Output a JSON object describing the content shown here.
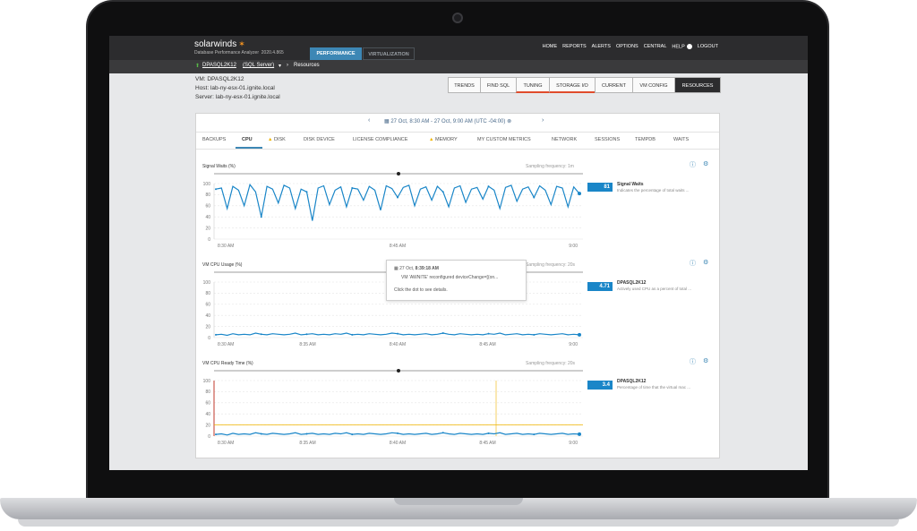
{
  "app": {
    "brand": "solarwinds",
    "product": "Database Performance Analyzer",
    "version": "2020.4.865",
    "main_tabs": [
      "PERFORMANCE",
      "VIRTUALIZATION"
    ],
    "nav": [
      "HOME",
      "REPORTS",
      "ALERTS",
      "OPTIONS",
      "CENTRAL",
      "HELP",
      "LOGOUT"
    ]
  },
  "breadcrumb": {
    "instance": "DPASQL2K12",
    "type": "(SQL Server)",
    "page": "Resources"
  },
  "info": {
    "vm": "VM: DPASQL2K12",
    "host": "Host: lab-ny-esx-01.ignite.local",
    "server": "Server: lab-ny-esx-01.ignite.local"
  },
  "view_tabs": [
    "TRENDS",
    "FIND SQL",
    "TUNING",
    "STORAGE I/O",
    "CURRENT",
    "VM CONFIG",
    "RESOURCES"
  ],
  "date_range": "27 Oct, 8:30 AM - 27 Oct, 9:00 AM (UTC -04:00)",
  "resource_tabs": [
    "BACKUPS",
    "CPU",
    "DISK",
    "DISK DEVICE",
    "LICENSE COMPLIANCE",
    "MEMORY",
    "MY CUSTOM METRICS",
    "NETWORK",
    "SESSIONS",
    "TEMPDB",
    "WAITS"
  ],
  "colors": {
    "accent": "#3d87b5",
    "series": "#1a86c8",
    "threshold": "#f0b400",
    "critical": "#e04c2c"
  },
  "charts": [
    {
      "title": "Signal Waits (%)",
      "sampling": "Sampling frequency: 1m",
      "current_value": "81",
      "legend_name": "Signal Waits",
      "legend_desc": "Indicates the percentage of total waits ...",
      "x_labels": [
        "8:30 AM",
        "8:45 AM",
        "9:00"
      ]
    },
    {
      "title": "VM CPU Usage (%)",
      "sampling": "Sampling frequency: 20s",
      "current_value": "4.71",
      "legend_name": "DPASQL2K12",
      "legend_desc": "Actively used CPU as a percent of total ...",
      "x_labels": [
        "8:30 AM",
        "8:35 AM",
        "8:40 AM",
        "8:45 AM",
        "9:00"
      ]
    },
    {
      "title": "VM CPU Ready Time (%)",
      "sampling": "Sampling frequency: 20s",
      "current_value": "3.4",
      "legend_name": "DPASQL2K12",
      "legend_desc": "Percentage of time that the virtual mac ...",
      "x_labels": [
        "8:30 AM",
        "8:35 AM",
        "8:40 AM",
        "8:45 AM",
        "9:00"
      ]
    }
  ],
  "tooltip": {
    "date": "27 Oct,",
    "time": "8:39:18 AM",
    "text": "VM 'AWNITE' reconfigured deviceChange=[(on...",
    "hint": "Click the dot to see details."
  },
  "chart_data": [
    {
      "type": "line",
      "title": "Signal Waits (%)",
      "ylim": [
        0,
        100
      ],
      "yticks": [
        0,
        20,
        40,
        60,
        80,
        100
      ],
      "series": [
        {
          "name": "Signal Waits",
          "values": [
            90,
            92,
            55,
            95,
            88,
            60,
            98,
            85,
            40,
            95,
            90,
            65,
            97,
            92,
            55,
            90,
            85,
            33,
            92,
            96,
            62,
            88,
            94,
            58,
            92,
            90,
            70,
            95,
            88,
            52,
            96,
            91,
            75,
            93,
            97,
            60,
            90,
            94,
            70,
            95,
            85,
            58,
            92,
            96,
            66,
            90,
            93,
            72,
            95,
            88,
            55,
            93,
            97,
            68,
            90,
            94,
            75,
            96,
            88,
            62,
            95,
            92,
            58,
            94,
            82
          ]
        }
      ]
    },
    {
      "type": "line",
      "title": "VM CPU Usage (%)",
      "ylim": [
        0,
        100
      ],
      "yticks": [
        0,
        20,
        40,
        60,
        80,
        100
      ],
      "series": [
        {
          "name": "DPASQL2K12",
          "values": [
            5,
            6,
            4,
            7,
            5,
            6,
            5,
            8,
            6,
            5,
            7,
            6,
            5,
            6,
            8,
            5,
            6,
            7,
            5,
            6,
            5,
            7,
            6,
            8,
            5,
            6,
            5,
            7,
            6,
            5,
            6,
            8,
            7,
            5,
            6,
            5,
            6,
            7,
            5,
            6,
            8,
            6,
            5,
            7,
            6,
            5,
            6,
            5,
            7,
            6,
            8,
            5,
            6,
            7,
            5,
            6,
            5,
            7,
            6,
            5,
            6,
            7,
            5,
            6,
            5
          ]
        }
      ]
    },
    {
      "type": "line",
      "title": "VM CPU Ready Time (%)",
      "ylim": [
        0,
        100
      ],
      "yticks": [
        0,
        20,
        40,
        60,
        80,
        100
      ],
      "series": [
        {
          "name": "DPASQL2K12",
          "values": [
            3,
            4,
            2,
            5,
            3,
            4,
            3,
            6,
            4,
            3,
            5,
            4,
            3,
            4,
            6,
            3,
            4,
            5,
            3,
            4,
            3,
            5,
            4,
            6,
            3,
            4,
            3,
            5,
            4,
            3,
            4,
            6,
            5,
            3,
            4,
            3,
            4,
            5,
            3,
            4,
            6,
            4,
            3,
            5,
            4,
            3,
            4,
            3,
            5,
            4,
            6,
            3,
            4,
            5,
            3,
            4,
            3,
            5,
            4,
            3,
            4,
            5,
            3,
            4,
            3.4
          ]
        }
      ]
    }
  ]
}
